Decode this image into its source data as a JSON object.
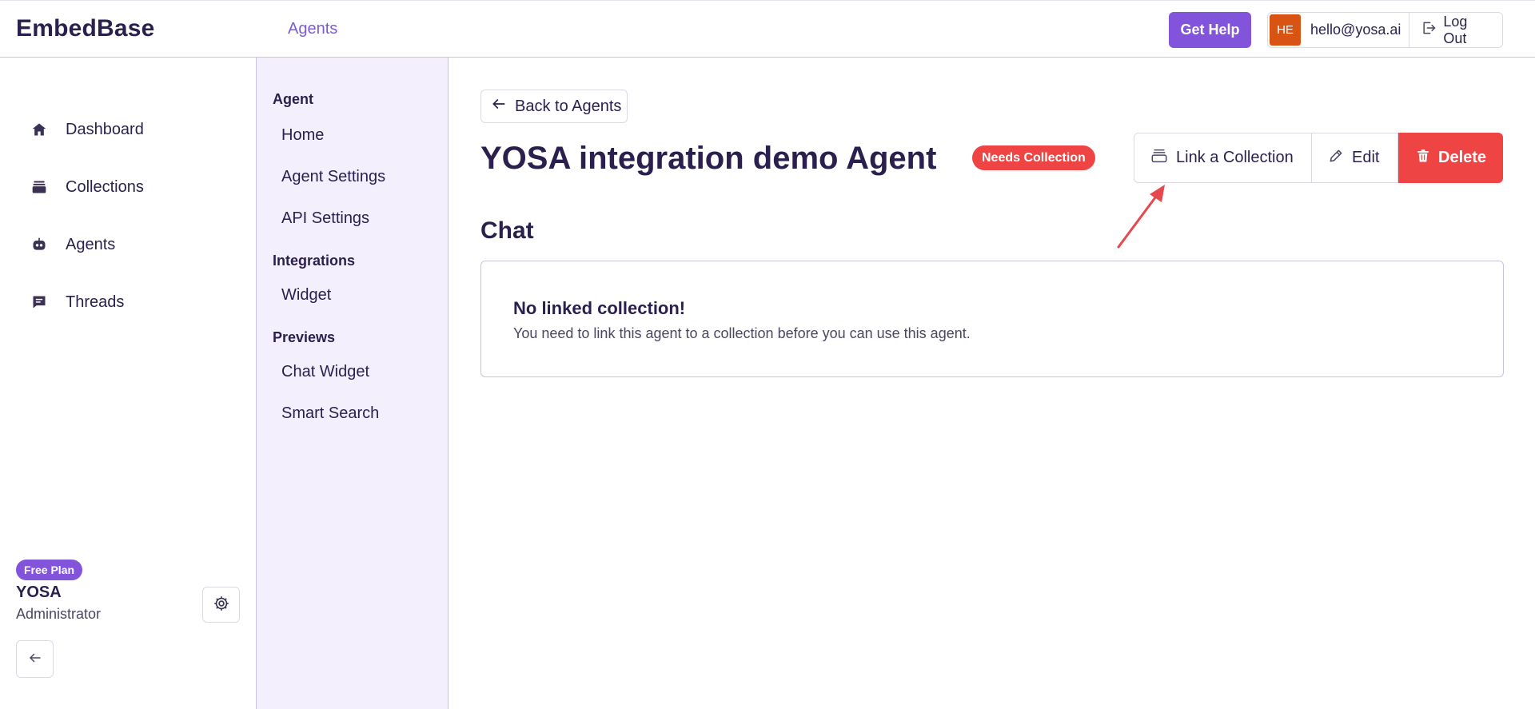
{
  "brand": {
    "name": "EmbedBase"
  },
  "topbar": {
    "crumb": "Agents",
    "help_label": "Get Help",
    "user": {
      "initials": "HE",
      "email": "hello@yosa.ai"
    },
    "logout_label": "Log Out"
  },
  "sidebar": {
    "items": [
      {
        "label": "Dashboard",
        "icon": "home-icon"
      },
      {
        "label": "Collections",
        "icon": "collections-icon"
      },
      {
        "label": "Agents",
        "icon": "robot-icon"
      },
      {
        "label": "Threads",
        "icon": "chat-icon"
      }
    ],
    "plan": "Free Plan",
    "org": "YOSA",
    "role": "Administrator"
  },
  "subnav": {
    "sections": [
      {
        "heading": "Agent",
        "links": [
          "Home",
          "Agent Settings",
          "API Settings"
        ]
      },
      {
        "heading": "Integrations",
        "links": [
          "Widget"
        ]
      },
      {
        "heading": "Previews",
        "links": [
          "Chat Widget",
          "Smart Search"
        ]
      }
    ]
  },
  "main": {
    "back_label": "Back to Agents",
    "title": "YOSA integration demo Agent",
    "status": "Needs Collection",
    "actions": {
      "link": "Link a Collection",
      "edit": "Edit",
      "delete": "Delete"
    },
    "chat_heading": "Chat",
    "notice": {
      "title": "No linked collection!",
      "text": "You need to link this agent to a collection before you can use this agent."
    }
  },
  "colors": {
    "accent": "#8254db",
    "danger": "#ef4444",
    "text": "#2a1f4d",
    "subnav_bg": "#f3effd",
    "avatar": "#d95412",
    "annotation": "#e5484d"
  }
}
